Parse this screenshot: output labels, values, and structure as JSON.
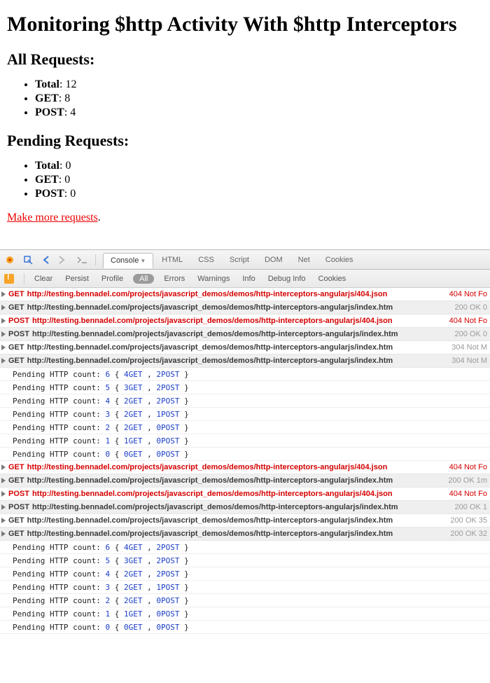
{
  "page": {
    "title": "Monitoring $http Activity With $http Interceptors",
    "allHeader": "All Requests:",
    "pendingHeader": "Pending Requests:",
    "labels": {
      "total": "Total",
      "get": "GET",
      "post": "POST"
    },
    "all": {
      "total": 12,
      "get": 8,
      "post": 4
    },
    "pending": {
      "total": 0,
      "get": 0,
      "post": 0
    },
    "actionLink": "Make more requests"
  },
  "devtools": {
    "topTabs": [
      "Console",
      "HTML",
      "CSS",
      "Script",
      "DOM",
      "Net",
      "Cookies"
    ],
    "activeTop": "Console",
    "subButtons": [
      "Clear",
      "Persist",
      "Profile"
    ],
    "subFilter": "All",
    "subTabs": [
      "Errors",
      "Warnings",
      "Info",
      "Debug Info",
      "Cookies"
    ],
    "entries": [
      {
        "kind": "net",
        "shade": false,
        "err": true,
        "method": "GET",
        "url": "http://testing.bennadel.com/projects/javascript_demos/demos/http-interceptors-angularjs/404.json",
        "status": "404 Not Fo"
      },
      {
        "kind": "net",
        "shade": true,
        "err": false,
        "method": "GET",
        "url": "http://testing.bennadel.com/projects/javascript_demos/demos/http-interceptors-angularjs/index.htm",
        "status": "200 OK 0"
      },
      {
        "kind": "net",
        "shade": false,
        "err": true,
        "method": "POST",
        "url": "http://testing.bennadel.com/projects/javascript_demos/demos/http-interceptors-angularjs/404.json",
        "status": "404 Not Fo"
      },
      {
        "kind": "net",
        "shade": true,
        "err": false,
        "method": "POST",
        "url": "http://testing.bennadel.com/projects/javascript_demos/demos/http-interceptors-angularjs/index.htm",
        "status": "200 OK 0"
      },
      {
        "kind": "net",
        "shade": false,
        "err": false,
        "method": "GET",
        "url": "http://testing.bennadel.com/projects/javascript_demos/demos/http-interceptors-angularjs/index.htm",
        "status": "304 Not M"
      },
      {
        "kind": "net",
        "shade": true,
        "err": false,
        "method": "GET",
        "url": "http://testing.bennadel.com/projects/javascript_demos/demos/http-interceptors-angularjs/index.htm",
        "status": "304 Not M"
      },
      {
        "kind": "log",
        "count": 6,
        "get": 4,
        "post": 2
      },
      {
        "kind": "log",
        "count": 5,
        "get": 3,
        "post": 2
      },
      {
        "kind": "log",
        "count": 4,
        "get": 2,
        "post": 2
      },
      {
        "kind": "log",
        "count": 3,
        "get": 2,
        "post": 1
      },
      {
        "kind": "log",
        "count": 2,
        "get": 2,
        "post": 0
      },
      {
        "kind": "log",
        "count": 1,
        "get": 1,
        "post": 0
      },
      {
        "kind": "log",
        "count": 0,
        "get": 0,
        "post": 0
      },
      {
        "kind": "net",
        "shade": false,
        "err": true,
        "method": "GET",
        "url": "http://testing.bennadel.com/projects/javascript_demos/demos/http-interceptors-angularjs/404.json",
        "status": "404 Not Fo"
      },
      {
        "kind": "net",
        "shade": true,
        "err": false,
        "method": "GET",
        "url": "http://testing.bennadel.com/projects/javascript_demos/demos/http-interceptors-angularjs/index.htm",
        "status": "200 OK 1m"
      },
      {
        "kind": "net",
        "shade": false,
        "err": true,
        "method": "POST",
        "url": "http://testing.bennadel.com/projects/javascript_demos/demos/http-interceptors-angularjs/404.json",
        "status": "404 Not Fo"
      },
      {
        "kind": "net",
        "shade": true,
        "err": false,
        "method": "POST",
        "url": "http://testing.bennadel.com/projects/javascript_demos/demos/http-interceptors-angularjs/index.htm",
        "status": "200 OK 1"
      },
      {
        "kind": "net",
        "shade": false,
        "err": false,
        "method": "GET",
        "url": "http://testing.bennadel.com/projects/javascript_demos/demos/http-interceptors-angularjs/index.htm",
        "status": "200 OK 35"
      },
      {
        "kind": "net",
        "shade": true,
        "err": false,
        "method": "GET",
        "url": "http://testing.bennadel.com/projects/javascript_demos/demos/http-interceptors-angularjs/index.htm",
        "status": "200 OK 32"
      },
      {
        "kind": "log",
        "count": 6,
        "get": 4,
        "post": 2
      },
      {
        "kind": "log",
        "count": 5,
        "get": 3,
        "post": 2
      },
      {
        "kind": "log",
        "count": 4,
        "get": 2,
        "post": 2
      },
      {
        "kind": "log",
        "count": 3,
        "get": 2,
        "post": 1
      },
      {
        "kind": "log",
        "count": 2,
        "get": 2,
        "post": 0
      },
      {
        "kind": "log",
        "count": 1,
        "get": 1,
        "post": 0
      },
      {
        "kind": "log",
        "count": 0,
        "get": 0,
        "post": 0
      }
    ]
  }
}
